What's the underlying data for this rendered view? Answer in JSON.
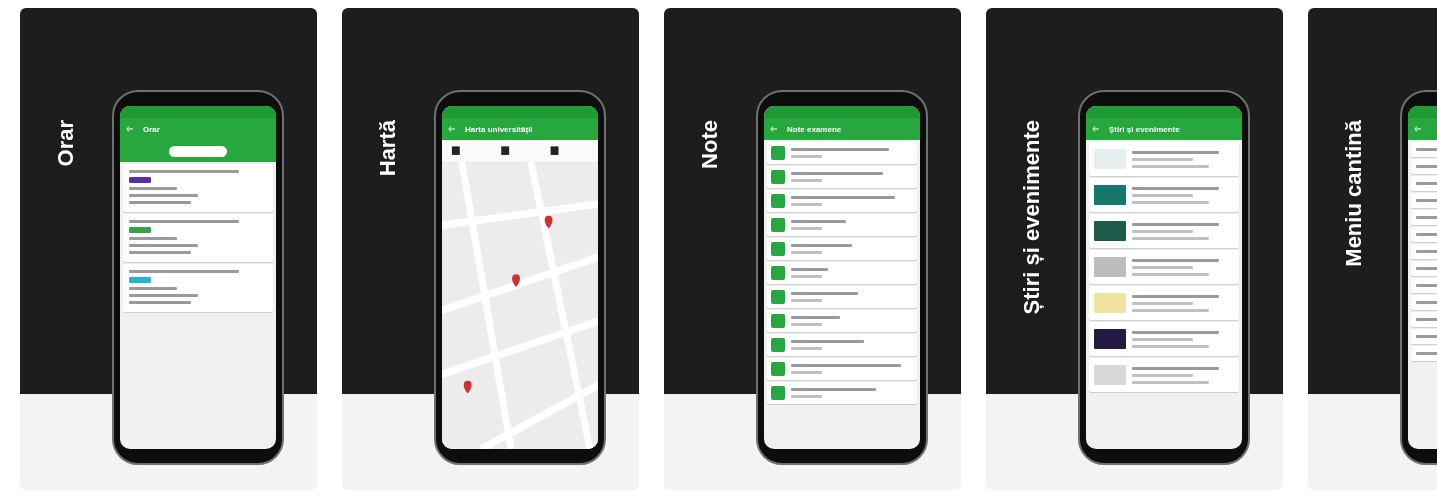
{
  "cards": [
    {
      "kind": "schedule",
      "caption": "Orar",
      "header": "Orar",
      "entries": [
        {
          "color": "#5a2ea6"
        },
        {
          "color": "#3aa04a"
        },
        {
          "color": "#29b5c9"
        }
      ]
    },
    {
      "kind": "map",
      "caption": "Hartă",
      "header": "Harta universității"
    },
    {
      "kind": "grades",
      "caption": "Note",
      "header": "Note examene"
    },
    {
      "kind": "news",
      "caption": "Știri și evenimente",
      "header": "Știri și evenimente"
    },
    {
      "kind": "menu",
      "caption": "Meniu cantină"
    }
  ]
}
